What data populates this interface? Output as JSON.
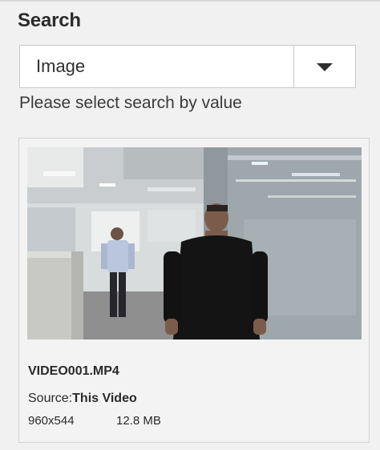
{
  "search": {
    "title": "Search",
    "selected_value": "Image",
    "hint": "Please select search by value"
  },
  "result": {
    "file_name": "VIDEO001.MP4",
    "source_label": "Source:",
    "source_value": "This Video",
    "dimensions": "960x544",
    "size": "12.8 MB"
  },
  "icons": {
    "dropdown": "chevron-down-icon"
  },
  "colors": {
    "panel_background": "#f1f1f1",
    "card_border": "#d2d2d2",
    "text": "#2a2a2a"
  }
}
